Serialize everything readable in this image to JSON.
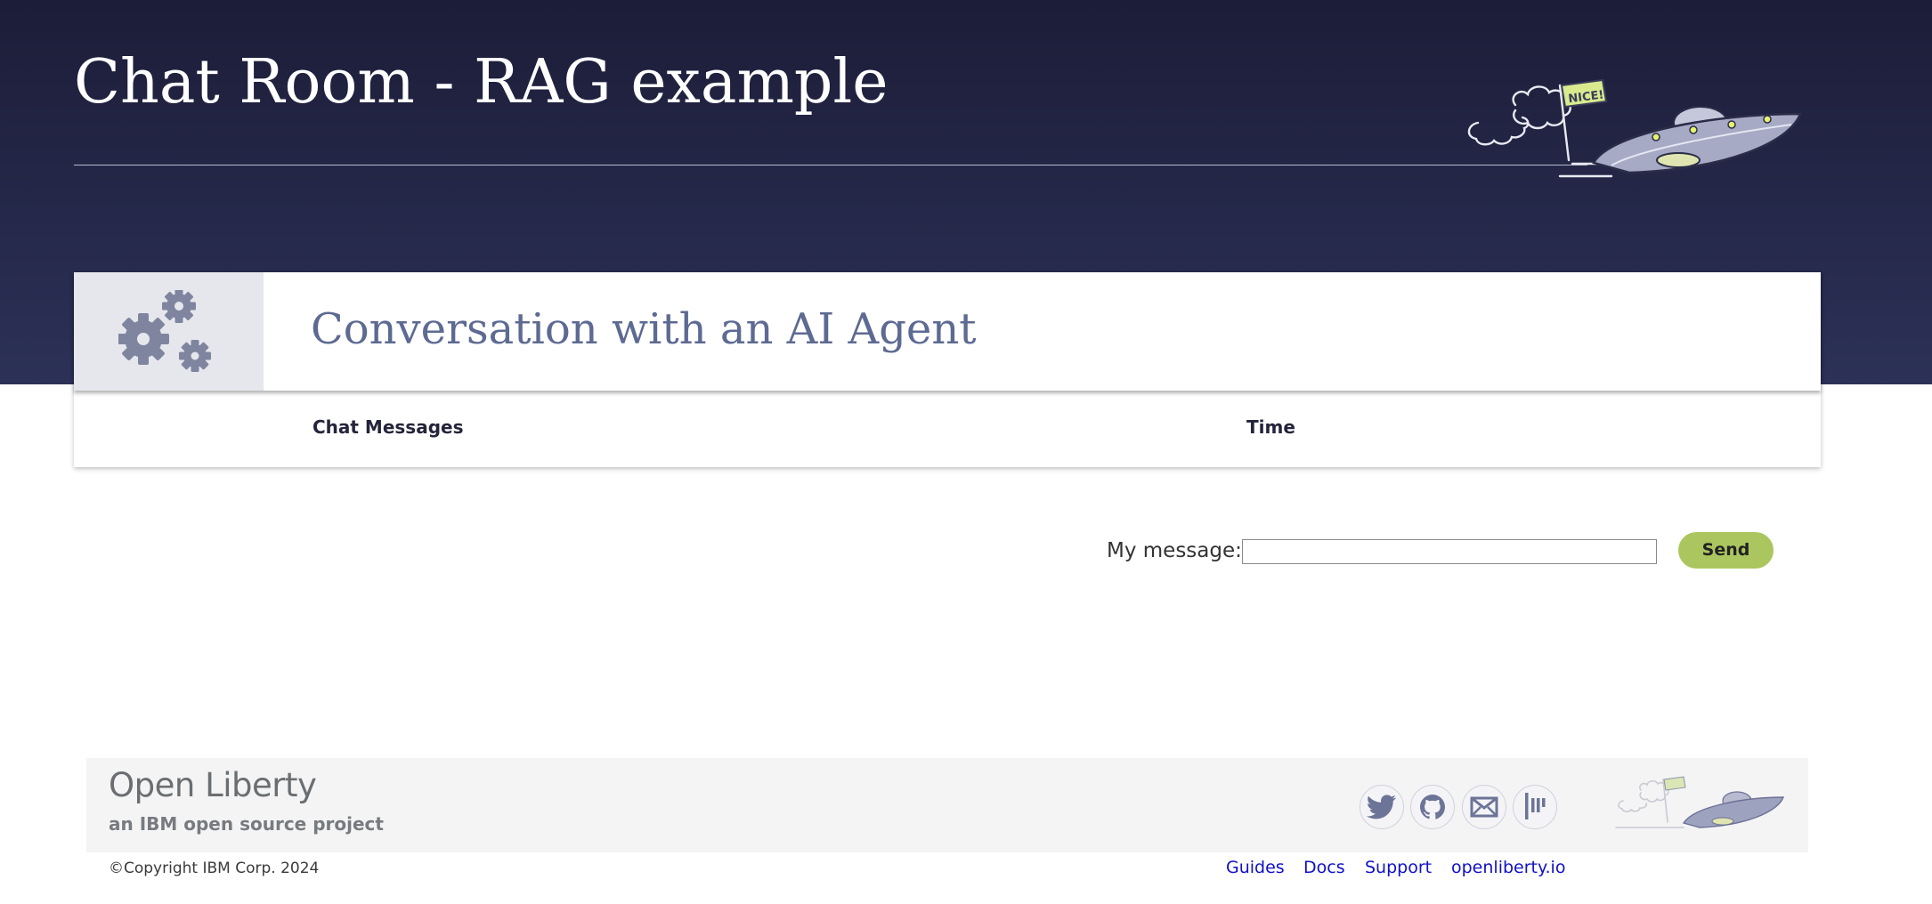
{
  "header": {
    "title": "Chat Room - RAG example",
    "mascot_flag_text": "NICE!"
  },
  "card": {
    "title": "Conversation with an AI Agent",
    "columns": [
      "Chat Messages",
      "Time"
    ]
  },
  "composer": {
    "label": "My message:",
    "input_value": "",
    "send_label": "Send"
  },
  "footer": {
    "logo": "Open Liberty",
    "tagline": "an IBM open source project",
    "copyright": "©Copyright IBM Corp. 2024",
    "social_icons": [
      "twitter-icon",
      "github-icon",
      "email-icon",
      "gitter-icon"
    ],
    "links": [
      "Guides",
      "Docs",
      "Support",
      "openliberty.io"
    ]
  },
  "colors": {
    "hero_top": "#1c1d38",
    "hero_bottom": "#2c3157",
    "accent_title": "#5d6a92",
    "send_button": "#abc65f",
    "link": "#1010c8"
  }
}
